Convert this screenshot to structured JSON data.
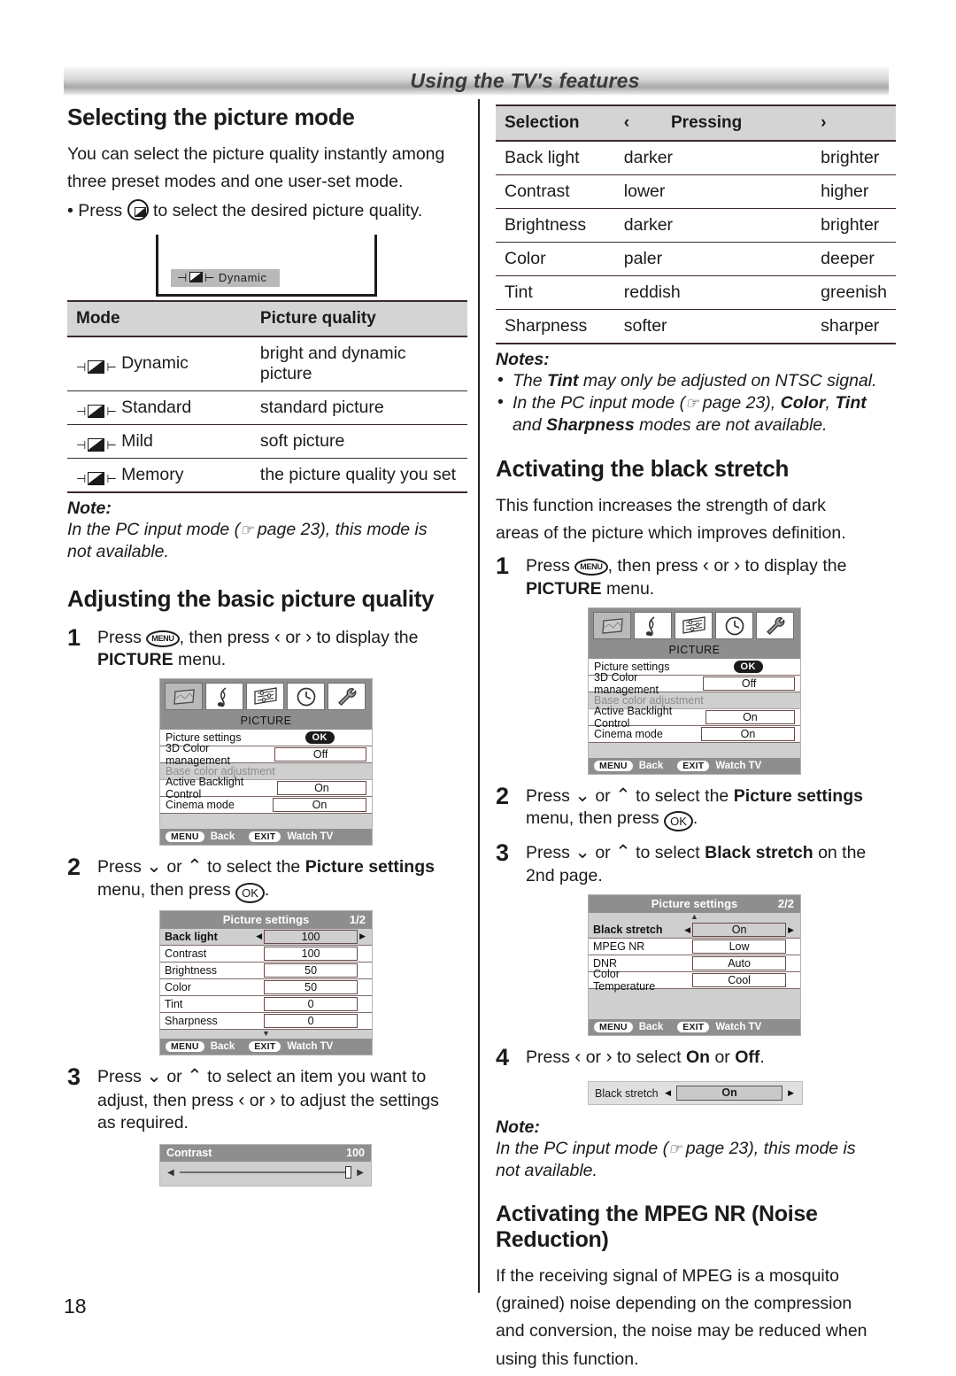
{
  "header": {
    "title": "Using the TV's features"
  },
  "page_number": "18",
  "left": {
    "section1": {
      "heading": "Selecting the picture mode",
      "intro_line1": "You can select the picture quality instantly among",
      "intro_line2": "three preset modes and one user-set mode.",
      "bullet_before": "• Press",
      "bullet_after": "to select the desired picture quality.",
      "tv_illustration": {
        "osd_label": "Dynamic"
      },
      "table": {
        "headers": [
          "Mode",
          "Picture quality"
        ],
        "rows": [
          {
            "mode": "Dynamic",
            "quality": "bright and dynamic picture"
          },
          {
            "mode": "Standard",
            "quality": "standard picture"
          },
          {
            "mode": "Mild",
            "quality": "soft picture"
          },
          {
            "mode": "Memory",
            "quality": "the picture quality you set"
          }
        ]
      },
      "note_title": "Note:",
      "note_line1_a": "In the PC input mode (",
      "note_line1_b": "page 23), this mode is",
      "note_line2": "not available."
    },
    "section2": {
      "heading": "Adjusting the basic picture quality",
      "step1": {
        "num": "1",
        "text_a": "Press",
        "text_b": ", then press",
        "text_c": "or",
        "text_d": "to display the",
        "menu_name": "PICTURE",
        "text_e": "menu."
      },
      "picture_menu": {
        "title": "PICTURE",
        "tabs": [
          "picture-icon",
          "music-note-icon",
          "settings-list-icon",
          "clock-icon",
          "wrench-icon"
        ],
        "rows": [
          {
            "label": "Picture settings",
            "value": "OK",
            "type": "ok"
          },
          {
            "label": "3D Color management",
            "value": "Off",
            "type": "value"
          },
          {
            "label": "Base color adjustment",
            "value": "",
            "type": "dim"
          },
          {
            "label": "Active Backlight Control",
            "value": "On",
            "type": "value"
          },
          {
            "label": "Cinema mode",
            "value": "On",
            "type": "value"
          }
        ],
        "footer": [
          {
            "key": "MENU",
            "label": "Back"
          },
          {
            "key": "EXIT",
            "label": "Watch TV"
          }
        ]
      },
      "step2": {
        "num": "2",
        "text_a": "Press",
        "text_b": "or",
        "text_c": "to select the",
        "bold": "Picture settings",
        "text_d": "menu, then press",
        "text_e": "."
      },
      "picture_settings": {
        "title": "Picture settings",
        "page": "1/2",
        "rows": [
          {
            "label": "Back light",
            "value": "100",
            "active": true
          },
          {
            "label": "Contrast",
            "value": "100",
            "active": false
          },
          {
            "label": "Brightness",
            "value": "50",
            "active": false
          },
          {
            "label": "Color",
            "value": "50",
            "active": false
          },
          {
            "label": "Tint",
            "value": "0",
            "active": false
          },
          {
            "label": "Sharpness",
            "value": "0",
            "active": false
          }
        ],
        "caret": "▼",
        "footer": [
          {
            "key": "MENU",
            "label": "Back"
          },
          {
            "key": "EXIT",
            "label": "Watch TV"
          }
        ]
      },
      "step3": {
        "num": "3",
        "text_a": "Press",
        "text_b": "or",
        "text_c": "to select an item you want to",
        "line2_a": "adjust, then press",
        "line2_b": "or",
        "line2_c": "to adjust the settings",
        "line3": "as required."
      },
      "contrast_slider": {
        "label": "Contrast",
        "value": "100"
      }
    }
  },
  "right": {
    "pressing_table": {
      "headers": [
        "Selection",
        "‹",
        "Pressing",
        "›"
      ],
      "rows": [
        {
          "selection": "Back light",
          "left": "darker",
          "right": "brighter"
        },
        {
          "selection": "Contrast",
          "left": "lower",
          "right": "higher"
        },
        {
          "selection": "Brightness",
          "left": "darker",
          "right": "brighter"
        },
        {
          "selection": "Color",
          "left": "paler",
          "right": "deeper"
        },
        {
          "selection": "Tint",
          "left": "reddish",
          "right": "greenish"
        },
        {
          "selection": "Sharpness",
          "left": "softer",
          "right": "sharper"
        }
      ]
    },
    "notes": {
      "title": "Notes:",
      "item1_a": "The ",
      "item1_bold": "Tint",
      "item1_b": " may only be adjusted on NTSC signal.",
      "item2_a": "In the PC input mode (",
      "item2_b": "page 23), ",
      "item2_bold1": "Color",
      "item2_c": ", ",
      "item2_bold2": "Tint",
      "item2_d": "and ",
      "item2_bold3": "Sharpness",
      "item2_e": " modes are not available."
    },
    "section_black_stretch": {
      "heading": "Activating the black stretch",
      "intro_line1": "This function increases the strength of dark",
      "intro_line2": "areas of the picture which improves definition.",
      "step1": {
        "num": "1",
        "text_a": "Press",
        "text_b": ", then press",
        "text_c": "or",
        "text_d": "to display the",
        "menu_name": "PICTURE",
        "text_e": "menu."
      },
      "picture_menu": {
        "title": "PICTURE",
        "rows": [
          {
            "label": "Picture settings",
            "value": "OK",
            "type": "ok"
          },
          {
            "label": "3D Color management",
            "value": "Off",
            "type": "value"
          },
          {
            "label": "Base color adjustment",
            "value": "",
            "type": "dim"
          },
          {
            "label": "Active Backlight Control",
            "value": "On",
            "type": "value"
          },
          {
            "label": "Cinema mode",
            "value": "On",
            "type": "value"
          }
        ],
        "footer": [
          {
            "key": "MENU",
            "label": "Back"
          },
          {
            "key": "EXIT",
            "label": "Watch TV"
          }
        ]
      },
      "step2": {
        "num": "2",
        "text_a": "Press",
        "text_b": "or",
        "text_c": "to select the",
        "bold": "Picture settings",
        "text_d": "menu, then press",
        "text_e": "."
      },
      "step3": {
        "num": "3",
        "text_a": "Press",
        "text_b": "or",
        "text_c": "to select",
        "bold": "Black stretch",
        "text_d": "on the",
        "line2": "2nd page."
      },
      "picture_settings": {
        "title": "Picture settings",
        "page": "2/2",
        "caret": "▲",
        "rows": [
          {
            "label": "Black stretch",
            "value": "On",
            "active": true
          },
          {
            "label": "MPEG NR",
            "value": "Low",
            "active": false
          },
          {
            "label": "DNR",
            "value": "Auto",
            "active": false
          },
          {
            "label": "Color Temperature",
            "value": "Cool",
            "active": false
          }
        ],
        "footer": [
          {
            "key": "MENU",
            "label": "Back"
          },
          {
            "key": "EXIT",
            "label": "Watch TV"
          }
        ]
      },
      "step4": {
        "num": "4",
        "text_a": "Press",
        "text_b": "or",
        "text_c": "to select",
        "bold1": "On",
        "text_d": "or",
        "bold2": "Off",
        "text_e": "."
      },
      "black_stretch_osd": {
        "label": "Black stretch",
        "value": "On"
      },
      "note_title": "Note:",
      "note_line1_a": "In the PC input mode (",
      "note_line1_b": "page 23), this mode is",
      "note_line2": "not available."
    },
    "section_mpeg": {
      "heading": "Activating the MPEG NR (Noise Reduction)",
      "line1": "If the receiving signal of MPEG is a mosquito",
      "line2": "(grained) noise depending on the compression",
      "line3": "and conversion, the noise may be reduced when",
      "line4": "using this function."
    }
  }
}
